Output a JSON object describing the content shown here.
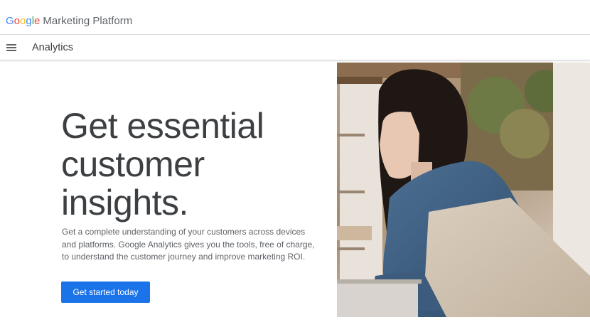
{
  "header": {
    "logo_letters": [
      {
        "char": "G",
        "color": "#4285F4"
      },
      {
        "char": "o",
        "color": "#EA4335"
      },
      {
        "char": "o",
        "color": "#FBBC05"
      },
      {
        "char": "g",
        "color": "#4285F4"
      },
      {
        "char": "l",
        "color": "#34A853"
      },
      {
        "char": "e",
        "color": "#EA4335"
      }
    ],
    "platform_label": "Marketing Platform"
  },
  "subnav": {
    "menu_icon": "hamburger-menu-icon",
    "product_name": "Analytics"
  },
  "hero": {
    "headline": "Get essential\ncustomer\ninsights.",
    "description": "Get a complete understanding of your customers across devices and platforms. Google Analytics gives you the tools, free of charge, to understand the customer journey and improve marketing ROI.",
    "cta_label": "Get started today",
    "photo": "woman-at-laptop-in-cafe-photo"
  },
  "colors": {
    "accent": "#1a73e8",
    "text_primary": "#3c4043",
    "text_secondary": "#5f6368"
  }
}
